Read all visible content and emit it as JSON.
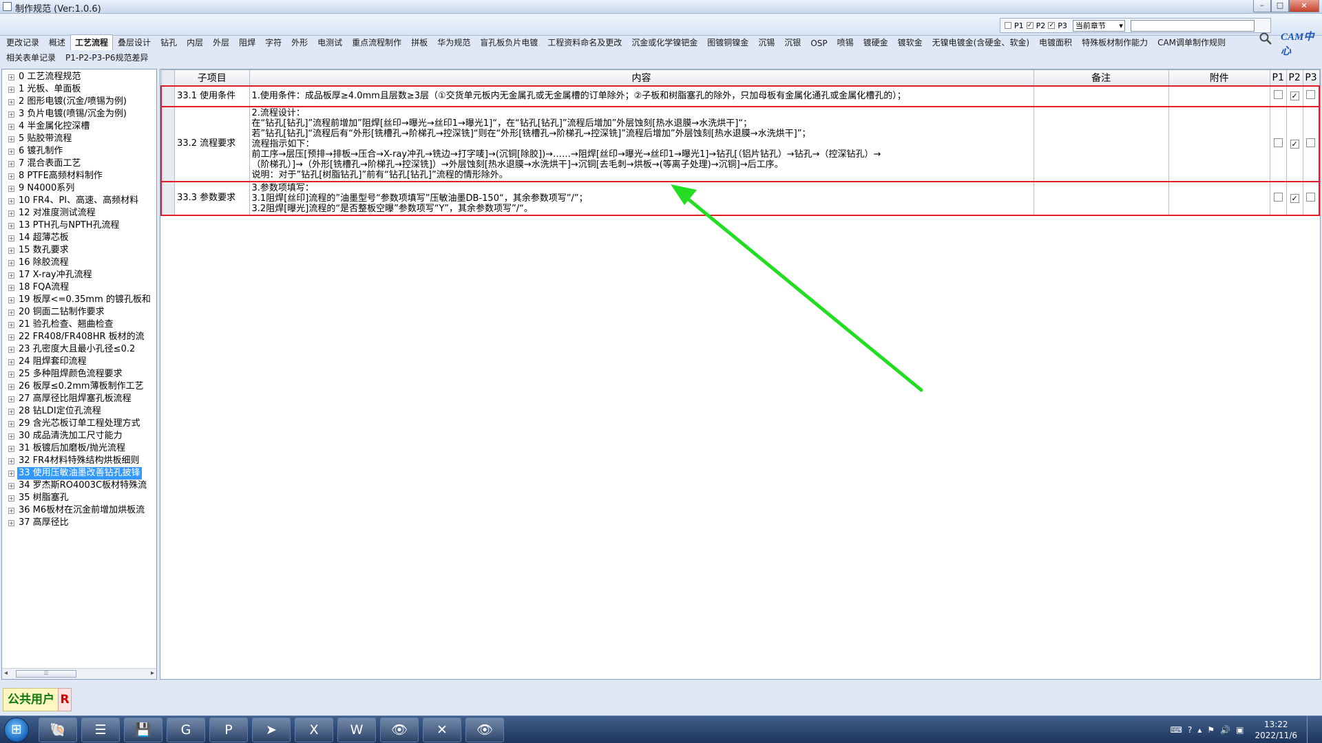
{
  "window": {
    "title": "制作规范 (Ver:1.0.6)",
    "min": "–",
    "max": "□",
    "close": "×"
  },
  "filter": {
    "p1": "P1",
    "p2": "P2",
    "p3": "P3",
    "p1_checked": false,
    "p2_checked": true,
    "p3_checked": true,
    "scope_value": "当前章节"
  },
  "logo": {
    "text": "CAM中心"
  },
  "tabs_row1": [
    "更改记录",
    "概述",
    "工艺流程",
    "叠层设计",
    "钻孔",
    "内层",
    "外层",
    "阻焊",
    "字符",
    "外形",
    "电测试",
    "重点流程制作",
    "拼板",
    "华为规范",
    "盲孔板负片电镀",
    "工程资料命名及更改",
    "沉金或化学镍钯金",
    "图镀铜镍金",
    "沉锡",
    "沉银",
    "OSP",
    "喷锡",
    "镀硬金",
    "镀软金",
    "无镍电镀金(含硬金、软金)",
    "电镀面积",
    "特殊板材制作能力",
    "CAM调单制作规则"
  ],
  "tabs_row2": [
    "相关表单记录",
    "P1-P2-P3-P6规范差异"
  ],
  "active_tab": "工艺流程",
  "tree": [
    "0 工艺流程规范",
    "1 光板、单面板",
    "2 图形电镀(沉金/喷锡为例)",
    "3 负片电镀(喷锡/沉金为例)",
    "4 半金属化控深槽",
    "5 贴胶带流程",
    "6 镀孔制作",
    "7 混合表面工艺",
    "8 PTFE高频材料制作",
    "9 N4000系列",
    "10 FR4、PI、高速、高频材料",
    "12 对准度测试流程",
    "13 PTH孔与NPTH孔流程",
    "14 超薄芯板",
    "15 数孔要求",
    "16 除胶流程",
    "17 X-ray冲孔流程",
    "18 FQA流程",
    "19 板厚<=0.35mm 的镀孔板和",
    "20 铜面二钻制作要求",
    "21 验孔检查、翘曲检查",
    "22 FR408/FR408HR 板材的流",
    "23 孔密度大且最小孔径≤0.2",
    "24 阻焊套印流程",
    "25 多种阻焊颜色流程要求",
    "26 板厚≤0.2mm薄板制作工艺",
    "27 高厚径比阻焊塞孔板流程",
    "28 钻LDI定位孔流程",
    "29 含光芯板订单工程处理方式",
    "30 成品清洗加工尺寸能力",
    "31 板镀后加磨板/抛光流程",
    "32 FR4材料特殊结构烘板细则",
    "33 使用压敏油墨改善钻孔披锋",
    "34 罗杰斯RO4003C板材特殊流",
    "35 树脂塞孔",
    "36 M6板材在沉金前增加烘板流",
    "37 高厚径比"
  ],
  "tree_selected_index": 32,
  "grid": {
    "headers": {
      "sub": "子项目",
      "content": "内容",
      "note": "备注",
      "attach": "附件",
      "p1": "P1",
      "p2": "P2",
      "p3": "P3"
    },
    "rows": [
      {
        "sub": "33.1 使用条件",
        "lines": [
          "1.使用条件：成品板厚≥4.0mm且层数≥3层（①交货单元板内无金属孔或无金属槽的订单除外；②子板和树脂塞孔的除外，只加母板有金属化通孔或金属化槽孔的）；"
        ],
        "p1": false,
        "p2": true,
        "p3": false
      },
      {
        "sub": "33.2 流程要求",
        "lines": [
          "2.流程设计：",
          "在“钻孔[钻孔]”流程前增加”阻焊[丝印→曝光→丝印1→曝光1]“，在“钻孔[钻孔]”流程后增加”外层蚀刻[热水退膜→水洗烘干]“；",
          "若”钻孔[钻孔]“流程后有“外形[铣槽孔→阶梯孔→控深铣]“则在“外形[铣槽孔→阶梯孔→控深铣]”流程后增加”外层蚀刻[热水退膜→水洗烘干]”；",
          "流程指示如下：",
          "前工序→层压[预排→排板→压合→X-ray冲孔→铣边→打字唛]→(沉铜[除胶])→……→阻焊[丝印→曝光→丝印1→曝光1]→钻孔[（铝片钻孔）→钻孔→（控深钻孔）→",
          "（阶梯孔）]→（外形[铣槽孔→阶梯孔→控深铣]）→外层蚀刻[热水退膜→水洗烘干]→沉铜[去毛刺→烘板→(等离子处理)→沉铜]→后工序。",
          "说明：对于”钻孔[树脂钻孔]”前有“钻孔[钻孔]”流程的情形除外。"
        ],
        "p1": false,
        "p2": true,
        "p3": false
      },
      {
        "sub": "33.3 参数要求",
        "lines": [
          "3.参数项填写：",
          "3.1阻焊[丝印]流程的”油墨型号“参数项填写”压敏油墨DB-150“，其余参数项写”/”；",
          "3.2阻焊[曝光]流程的“是否整板空曝”参数项写“Y”，其余参数项写”/“。"
        ],
        "p1": false,
        "p2": true,
        "p3": false
      }
    ]
  },
  "status": {
    "user": "公共用户",
    "r": "R"
  },
  "annotation": {
    "color": "#22dd22"
  },
  "taskbar": {
    "apps": [
      "browser-icon",
      "notepad-icon",
      "save-icon",
      "app-red-icon",
      "app-green-icon",
      "app-blue-icon",
      "excel-icon",
      "word-icon",
      "viewer-icon",
      "cam-icon",
      "viewer2-icon"
    ],
    "time": "13:22",
    "date": "2022/11/6"
  }
}
